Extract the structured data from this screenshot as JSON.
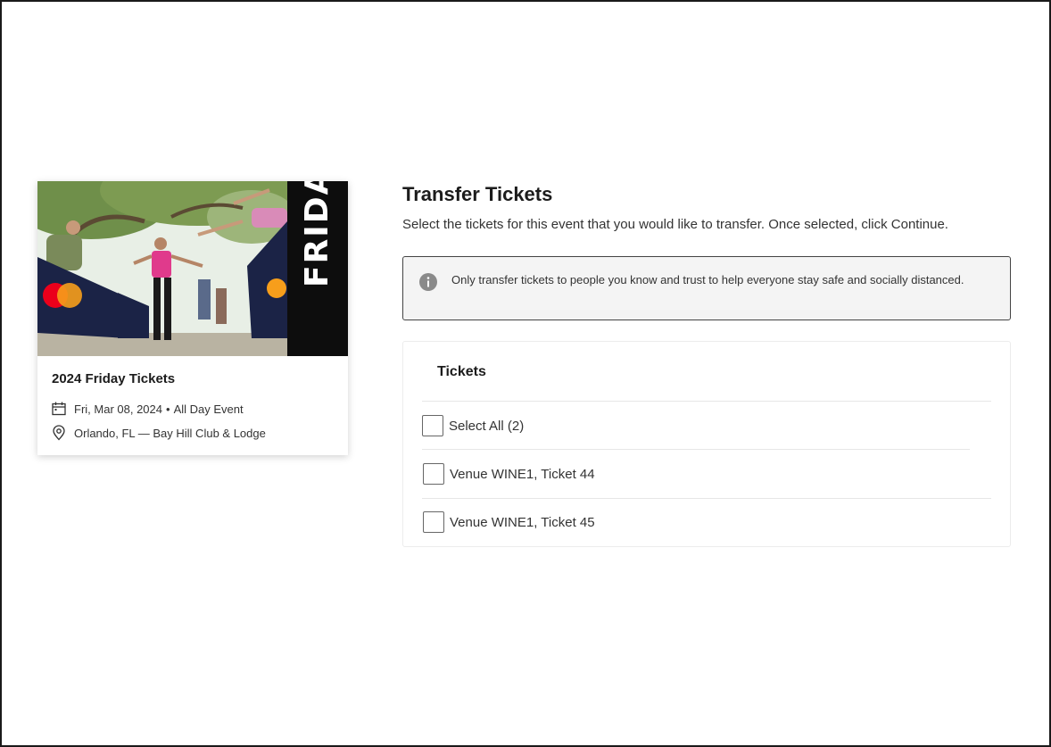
{
  "event": {
    "image_banner_text": "FRIDAY",
    "title": "2024 Friday Tickets",
    "date": "Fri, Mar 08, 2024",
    "separator": "•",
    "time": "All Day Event",
    "location": "Orlando, FL — Bay Hill Club & Lodge"
  },
  "transfer": {
    "title": "Transfer Tickets",
    "description": "Select the tickets for this event that you would like to transfer. Once selected, click Continue.",
    "notice": "Only transfer tickets to people you know and trust to help everyone stay safe and socially distanced."
  },
  "tickets": {
    "heading": "Tickets",
    "select_all_label": "Select All (2)",
    "items": [
      {
        "label": "Venue WINE1, Ticket 44",
        "checked": false
      },
      {
        "label": "Venue WINE1, Ticket 45",
        "checked": false
      }
    ]
  },
  "colors": {
    "notice_bg": "#f4f4f4",
    "banner_bg": "#0d0d0d",
    "mastercard_red": "#eb001b",
    "mastercard_orange": "#f79e1b"
  }
}
